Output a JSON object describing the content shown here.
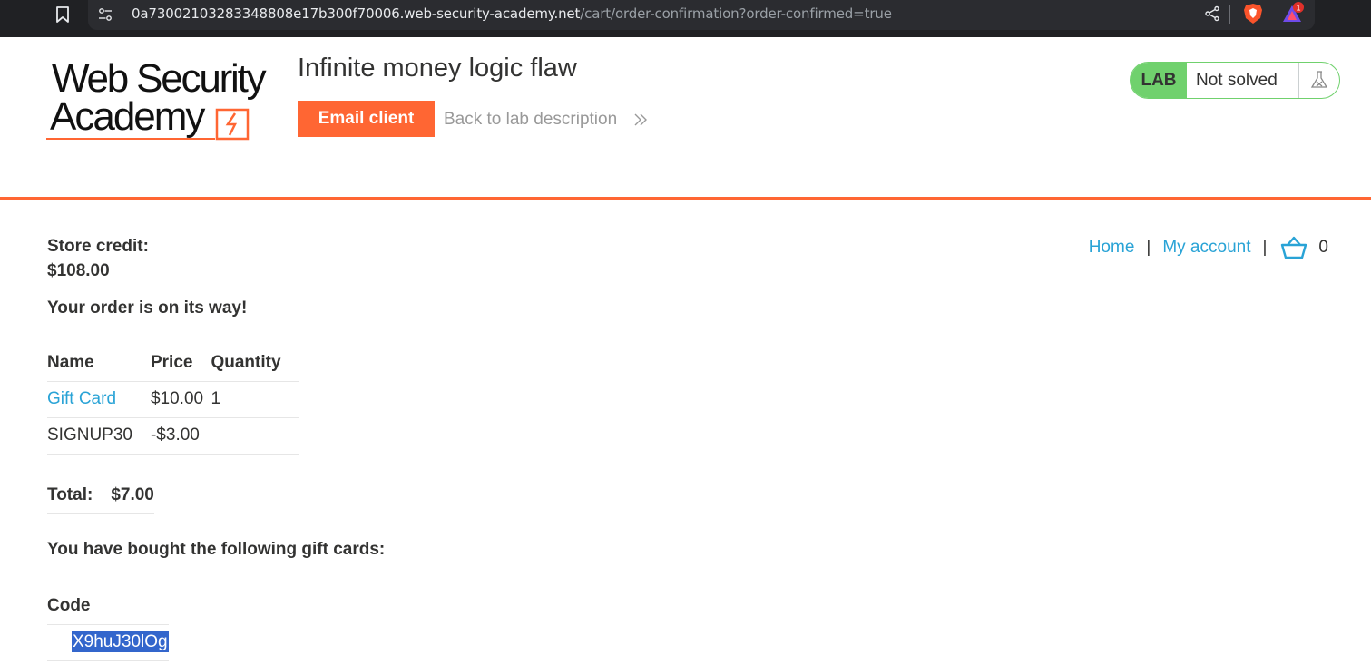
{
  "browser": {
    "url_host": "0a73002103283348808e17b300f70006.web-security-academy.net",
    "url_path": "/cart/order-confirmation?order-confirmed=true",
    "notification_count": "1",
    "icons": [
      "bookmark-icon",
      "tune-icon",
      "share-icon",
      "brave-shield-icon",
      "brave-rewards-icon"
    ]
  },
  "header": {
    "logo_line1": "Web Security",
    "logo_line2": "Academy",
    "lab_title": "Infinite money logic flaw",
    "email_client_label": "Email client",
    "back_link_label": "Back to lab description",
    "lab_badge": "LAB",
    "lab_status": "Not solved",
    "colors": {
      "accent": "#ff6633",
      "lab_green": "#70d16d",
      "link": "#29a3d6"
    }
  },
  "nav": {
    "home": "Home",
    "separator": "|",
    "my_account": "My account",
    "cart_count": "0"
  },
  "account": {
    "credit_label": "Store credit:",
    "credit_value": "$108.00",
    "order_message": "Your order is on its way!"
  },
  "order": {
    "columns": [
      "Name",
      "Price",
      "Quantity"
    ],
    "rows": [
      {
        "name": "Gift Card",
        "price": "$10.00",
        "quantity": "1"
      },
      {
        "name": "SIGNUP30",
        "price": "-$3.00",
        "quantity": ""
      }
    ],
    "total_label": "Total:",
    "total_value": "$7.00"
  },
  "gift_cards": {
    "heading": "You have bought the following gift cards:",
    "column": "Code",
    "codes": [
      "X9huJ30lOg"
    ]
  }
}
